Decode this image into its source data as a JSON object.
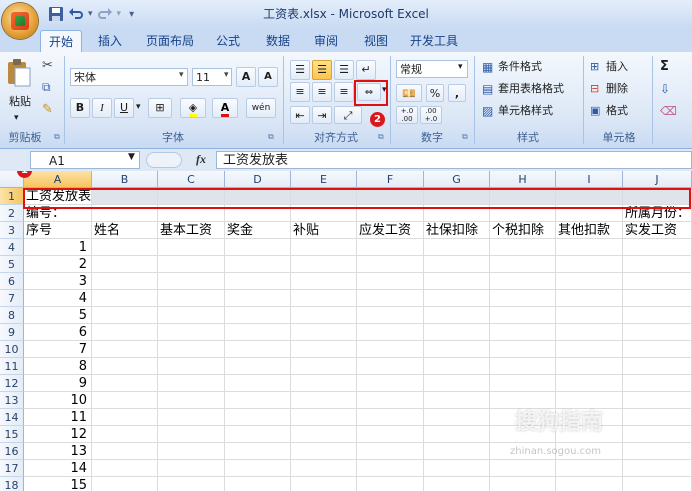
{
  "window": {
    "title": "工资表.xlsx - Microsoft Excel"
  },
  "tabs": [
    "开始",
    "插入",
    "页面布局",
    "公式",
    "数据",
    "审阅",
    "视图",
    "开发工具"
  ],
  "ribbon": {
    "clipboard": {
      "paste_label": "粘贴",
      "group_label": "剪贴板"
    },
    "font": {
      "font_name": "宋体",
      "font_size": "11",
      "grow": "A",
      "shrink": "A",
      "bold": "B",
      "italic": "I",
      "underline": "U",
      "phonetic": "wén",
      "group_label": "字体"
    },
    "alignment": {
      "group_label": "对齐方式"
    },
    "number": {
      "format": "常规",
      "percent": "%",
      "comma": ",",
      "inc_decimal": "+.0 .00",
      "dec_decimal": ".00 +.0",
      "group_label": "数字"
    },
    "styles": {
      "conditional": "条件格式",
      "table": "套用表格格式",
      "cell_styles": "单元格样式",
      "group_label": "样式"
    },
    "cells": {
      "insert": "插入",
      "delete": "删除",
      "format": "格式",
      "group_label": "单元格"
    },
    "editing": {
      "sigma": "Σ"
    }
  },
  "formula_bar": {
    "name_box": "A1",
    "fx": "fx",
    "content": "工资发放表"
  },
  "annotations": {
    "badge1": "1",
    "badge2": "2"
  },
  "accent": {
    "red_highlight": "#e01010",
    "ribbon_blue": "#15428b"
  },
  "columns": [
    "A",
    "B",
    "C",
    "D",
    "E",
    "F",
    "G",
    "H",
    "I",
    "J"
  ],
  "rows": [
    "1",
    "2",
    "3",
    "4",
    "5",
    "6",
    "7",
    "8",
    "9",
    "10",
    "11",
    "12",
    "13",
    "14",
    "15",
    "16",
    "17",
    "18"
  ],
  "sheet": {
    "a1": "工资发放表",
    "a2": "编号：",
    "j2": "所属月份：",
    "headers": [
      "序号",
      "姓名",
      "基本工资",
      "奖金",
      "补贴",
      "应发工资",
      "社保扣除",
      "个税扣除",
      "其他扣款",
      "实发工资"
    ],
    "serials": [
      "1",
      "2",
      "3",
      "4",
      "5",
      "6",
      "7",
      "8",
      "9",
      "10",
      "11",
      "12",
      "13",
      "14",
      "15"
    ]
  },
  "watermark": {
    "brand": "搜狗指南",
    "url": "zhinan.sogou.com"
  }
}
